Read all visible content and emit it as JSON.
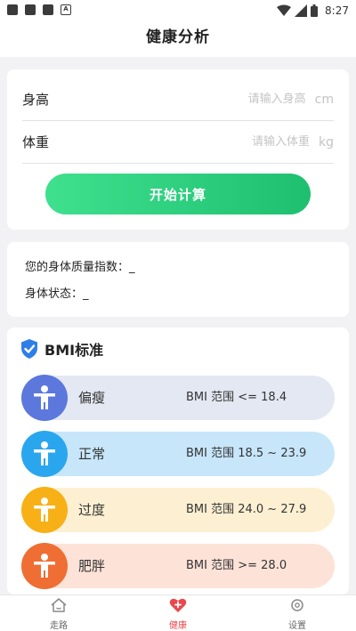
{
  "status_bar": {
    "time": "8:27"
  },
  "header": {
    "title": "健康分析"
  },
  "form": {
    "height_label": "身高",
    "height_placeholder": "请输入身高",
    "height_unit": "cm",
    "weight_label": "体重",
    "weight_placeholder": "请输入体重",
    "weight_unit": "kg",
    "calc_button": "开始计算"
  },
  "result": {
    "bmi_label": "您的身体质量指数：",
    "bmi_value": "_",
    "state_label": "身体状态：",
    "state_value": "_"
  },
  "bmi_standard": {
    "title": "BMI标准",
    "items": [
      {
        "name": "偏瘦",
        "range": "BMI 范围 <= 18.4",
        "bg": "#e3e8f3",
        "icon_color": "#5c78dd"
      },
      {
        "name": "正常",
        "range": "BMI 范围 18.5 ~ 23.9",
        "bg": "#c7e6fa",
        "icon_color": "#2aa6ee"
      },
      {
        "name": "过度",
        "range": "BMI 范围 24.0 ~ 27.9",
        "bg": "#fdf0d2",
        "icon_color": "#f7b016"
      },
      {
        "name": "肥胖",
        "range": "BMI 范围 >= 28.0",
        "bg": "#fde2d8",
        "icon_color": "#ef6e33"
      }
    ]
  },
  "tabs": [
    {
      "label": "走路",
      "active": false
    },
    {
      "label": "健康",
      "active": true
    },
    {
      "label": "设置",
      "active": false
    }
  ],
  "colors": {
    "accent_green": "#22c576",
    "active_tab": "#e8484d",
    "shield_blue": "#2f7ee8"
  }
}
